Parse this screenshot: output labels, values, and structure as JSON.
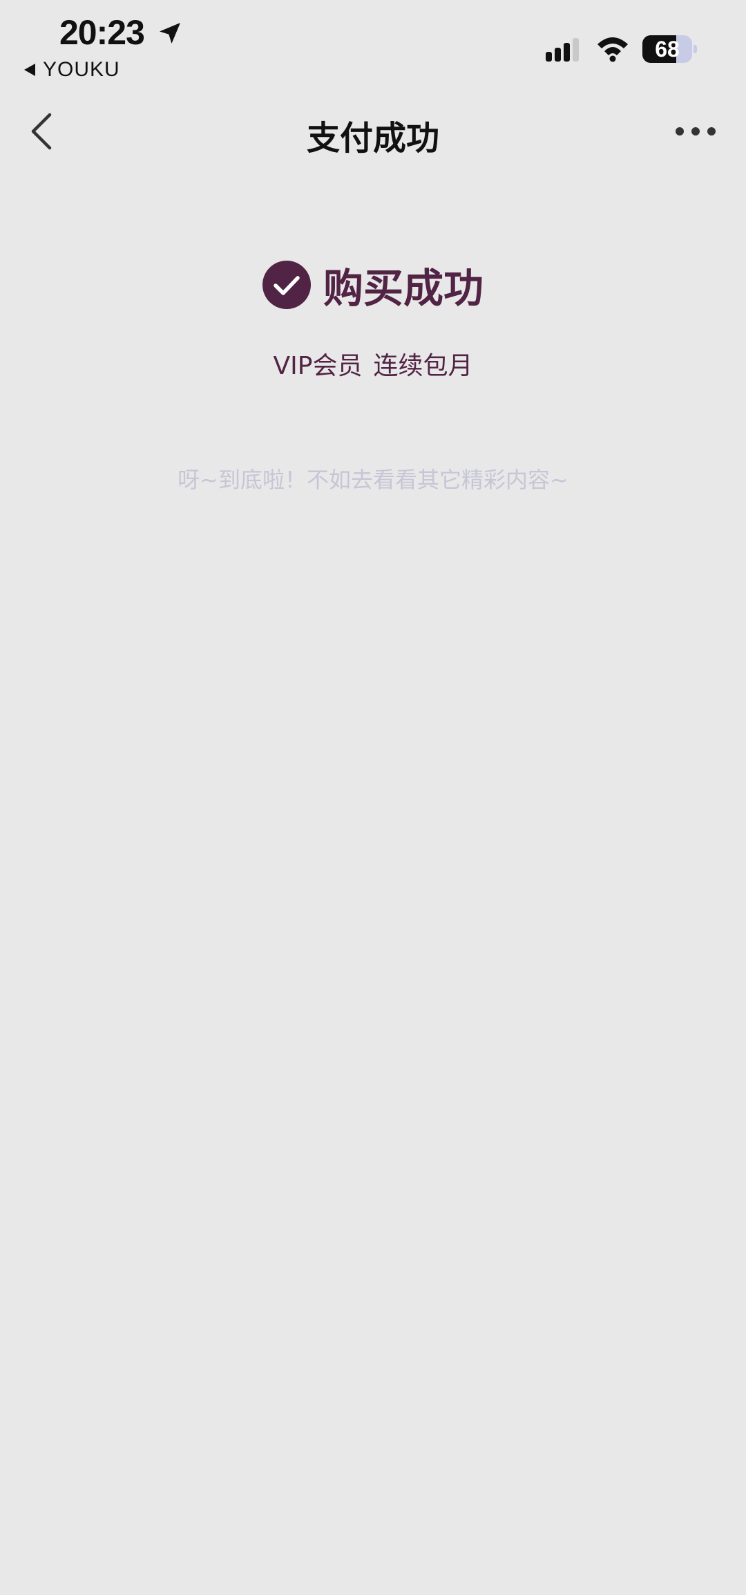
{
  "status_bar": {
    "time": "20:23",
    "back_app_label": "YOUKU",
    "battery_level": "68",
    "battery_fraction": 0.68,
    "location_icon": "location-arrow-icon",
    "signal_icon": "cellular-signal-icon",
    "wifi_icon": "wifi-icon"
  },
  "nav": {
    "title": "支付成功",
    "back_icon": "chevron-left-icon",
    "more_icon": "more-dots-icon"
  },
  "result": {
    "title": "购买成功",
    "icon": "check-circle-icon",
    "product_name": "VIP会员",
    "product_plan": "连续包月"
  },
  "footer_hint": "呀~到底啦！不如去看看其它精彩内容~",
  "colors": {
    "background": "#e8e8e9",
    "accent": "#512344",
    "hint": "#c6c6d6",
    "text": "#111111"
  }
}
